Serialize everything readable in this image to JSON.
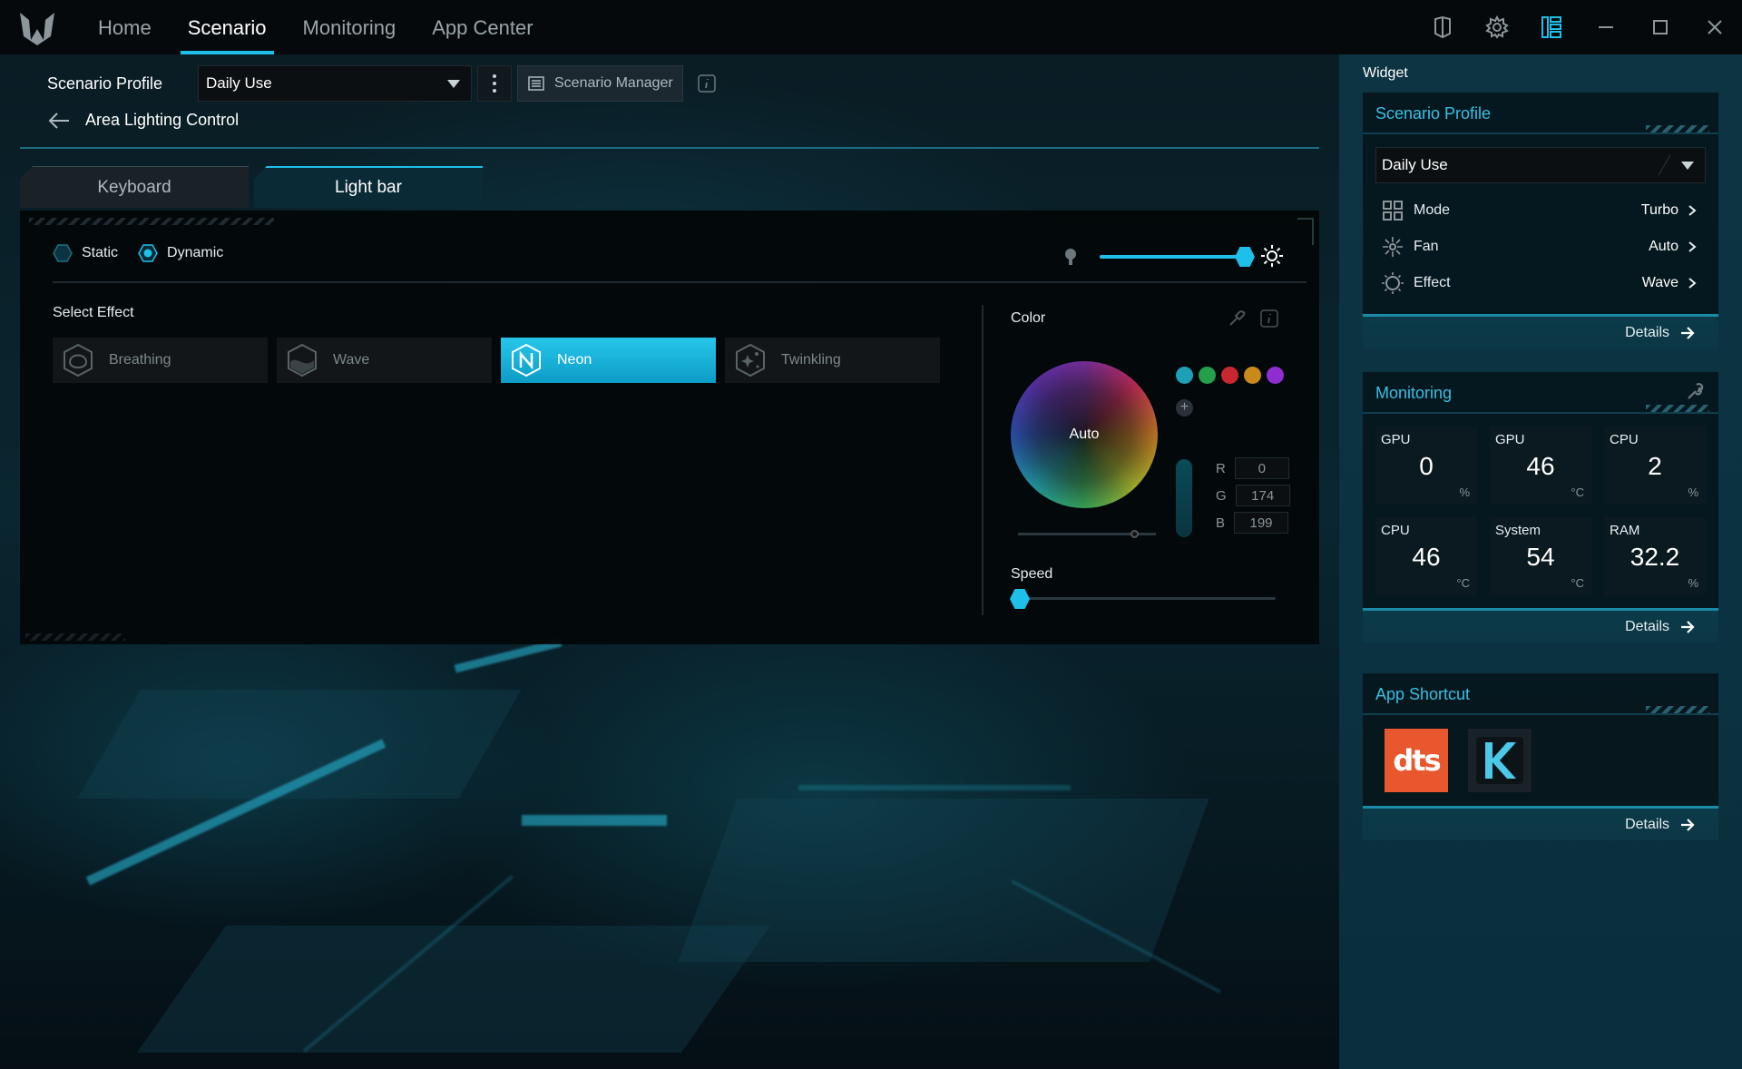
{
  "nav": {
    "items": [
      "Home",
      "Scenario",
      "Monitoring",
      "App Center"
    ],
    "active": "Scenario"
  },
  "header": {
    "profile_label": "Scenario Profile",
    "profile_value": "Daily Use",
    "manager_label": "Scenario Manager",
    "breadcrumb_title": "Area Lighting Control"
  },
  "tabs": [
    "Keyboard",
    "Light bar"
  ],
  "lighting": {
    "modes": [
      "Static",
      "Dynamic"
    ],
    "selected_mode": "Dynamic",
    "brightness_percent": 100,
    "select_effect_label": "Select Effect",
    "effects": [
      "Breathing",
      "Wave",
      "Neon",
      "Twinkling"
    ],
    "selected_effect": "Neon",
    "color_label": "Color",
    "wheel_label": "Auto",
    "swatches": [
      "#1d9fb6",
      "#25a04a",
      "#c8272f",
      "#c98a1a",
      "#8e2ed0"
    ],
    "rgb": {
      "r_label": "R",
      "r": "0",
      "g_label": "G",
      "g": "174",
      "b_label": "B",
      "b": "199"
    },
    "speed_label": "Speed",
    "speed_percent": 0
  },
  "widget": {
    "title": "Widget",
    "scenario": {
      "title": "Scenario Profile",
      "profile_value": "Daily Use",
      "rows": [
        {
          "name": "Mode",
          "value": "Turbo"
        },
        {
          "name": "Fan",
          "value": "Auto"
        },
        {
          "name": "Effect",
          "value": "Wave"
        }
      ],
      "details": "Details"
    },
    "monitoring": {
      "title": "Monitoring",
      "tiles": [
        {
          "label": "GPU",
          "value": "0",
          "unit": "%"
        },
        {
          "label": "GPU",
          "value": "46",
          "unit": "°C"
        },
        {
          "label": "CPU",
          "value": "2",
          "unit": "%"
        },
        {
          "label": "CPU",
          "value": "46",
          "unit": "°C"
        },
        {
          "label": "System",
          "value": "54",
          "unit": "°C"
        },
        {
          "label": "RAM",
          "value": "32.2",
          "unit": "%"
        }
      ],
      "details": "Details"
    },
    "shortcut": {
      "title": "App Shortcut",
      "apps": [
        "dts",
        "K"
      ],
      "details": "Details"
    }
  },
  "colors": {
    "accent": "#1ec0ea",
    "widget_title": "#39bfe4",
    "dts_brand": "#e8572e"
  }
}
